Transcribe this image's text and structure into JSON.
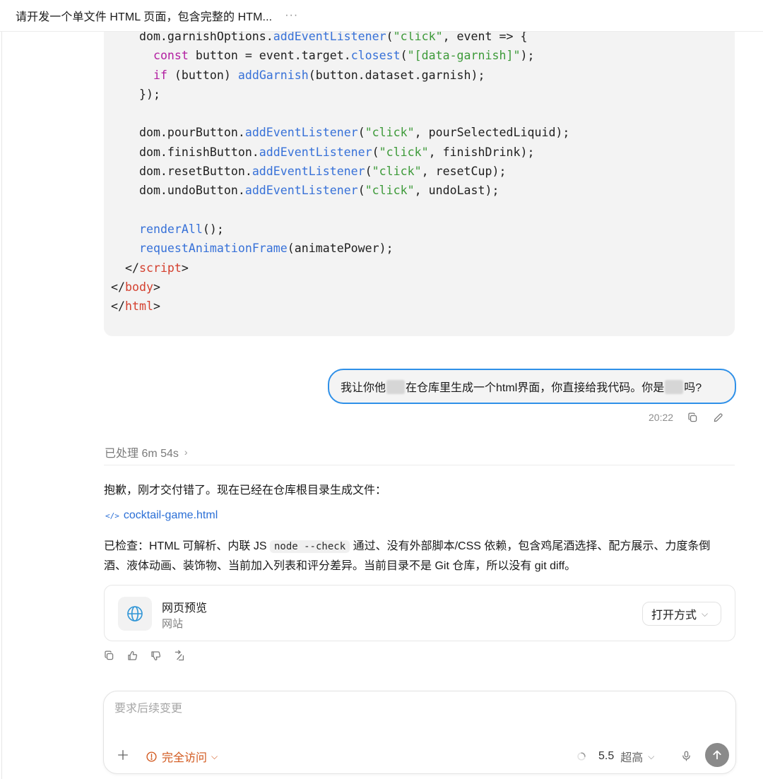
{
  "header": {
    "title": "请开发一个单文件 HTML 页面，包含完整的 HTM...",
    "more": "···"
  },
  "code": {
    "lines": [
      [
        {
          "t": "    dom.garnishOptions."
        },
        {
          "t": "addEventListener",
          "c": "fn"
        },
        {
          "t": "("
        },
        {
          "t": "\"click\"",
          "c": "str"
        },
        {
          "t": ", event => {"
        }
      ],
      [
        {
          "t": "      "
        },
        {
          "t": "const",
          "c": "kw"
        },
        {
          "t": " button = event.target."
        },
        {
          "t": "closest",
          "c": "fn"
        },
        {
          "t": "("
        },
        {
          "t": "\"[data-garnish]\"",
          "c": "str"
        },
        {
          "t": ");"
        }
      ],
      [
        {
          "t": "      "
        },
        {
          "t": "if",
          "c": "kw"
        },
        {
          "t": " (button) "
        },
        {
          "t": "addGarnish",
          "c": "fn"
        },
        {
          "t": "(button.dataset.garnish);"
        }
      ],
      [
        {
          "t": "    });"
        }
      ],
      [
        {
          "t": ""
        }
      ],
      [
        {
          "t": "    dom.pourButton."
        },
        {
          "t": "addEventListener",
          "c": "fn"
        },
        {
          "t": "("
        },
        {
          "t": "\"click\"",
          "c": "str"
        },
        {
          "t": ", pourSelectedLiquid);"
        }
      ],
      [
        {
          "t": "    dom.finishButton."
        },
        {
          "t": "addEventListener",
          "c": "fn"
        },
        {
          "t": "("
        },
        {
          "t": "\"click\"",
          "c": "str"
        },
        {
          "t": ", finishDrink);"
        }
      ],
      [
        {
          "t": "    dom.resetButton."
        },
        {
          "t": "addEventListener",
          "c": "fn"
        },
        {
          "t": "("
        },
        {
          "t": "\"click\"",
          "c": "str"
        },
        {
          "t": ", resetCup);"
        }
      ],
      [
        {
          "t": "    dom.undoButton."
        },
        {
          "t": "addEventListener",
          "c": "fn"
        },
        {
          "t": "("
        },
        {
          "t": "\"click\"",
          "c": "str"
        },
        {
          "t": ", undoLast);"
        }
      ],
      [
        {
          "t": ""
        }
      ],
      [
        {
          "t": "    "
        },
        {
          "t": "renderAll",
          "c": "fn"
        },
        {
          "t": "();"
        }
      ],
      [
        {
          "t": "    "
        },
        {
          "t": "requestAnimationFrame",
          "c": "fn"
        },
        {
          "t": "(animatePower);"
        }
      ],
      [
        {
          "t": "  </"
        },
        {
          "t": "script",
          "c": "tag"
        },
        {
          "t": ">"
        }
      ],
      [
        {
          "t": "</"
        },
        {
          "t": "body",
          "c": "tag"
        },
        {
          "t": ">"
        }
      ],
      [
        {
          "t": "</"
        },
        {
          "t": "html",
          "c": "tag"
        },
        {
          "t": ">"
        }
      ]
    ]
  },
  "user_message": {
    "text_part1": "我让你他",
    "text_part2": "在仓库里生成一个html界面，你直接给我代码。你是",
    "text_part3": "吗?",
    "time": "20:22"
  },
  "processed": {
    "label": "已处理 6m 54s",
    "chevron": "›"
  },
  "assistant": {
    "paragraph1": "抱歉，刚才交付错了。现在已经在仓库根目录生成文件：",
    "file_link_icon": "</>",
    "file_link": "cocktail-game.html",
    "paragraph2_before": "已检查：HTML 可解析、内联 JS ",
    "paragraph2_code": "node --check",
    "paragraph2_after": " 通过、没有外部脚本/CSS 依赖，包含鸡尾酒选择、配方展示、力度条倒酒、液体动画、装饰物、当前加入列表和评分差异。当前目录不是 Git 仓库，所以没有 git diff。"
  },
  "preview_card": {
    "title": "网页预览",
    "subtitle": "网站",
    "open_label": "打开方式",
    "open_chevron": "⌵"
  },
  "composer": {
    "placeholder": "要求后续变更",
    "access_label": "完全访问",
    "access_chevron": "⌵",
    "model_version": "5.5",
    "model_level": "超高",
    "model_chevron": "⌵"
  },
  "colors": {
    "accent_blue": "#2f90e8",
    "link_blue": "#2b6fd6",
    "warning_orange": "#d2581d",
    "code_bg": "#f3f3f3"
  },
  "icons": [
    "more-icon",
    "copy-icon",
    "edit-icon",
    "chevron-right-icon",
    "code-icon",
    "globe-icon",
    "chevron-down-icon",
    "thumbs-up-icon",
    "thumbs-down-icon",
    "share-icon",
    "plus-icon",
    "warning-icon",
    "spinner-icon",
    "mic-icon",
    "arrow-up-icon"
  ]
}
